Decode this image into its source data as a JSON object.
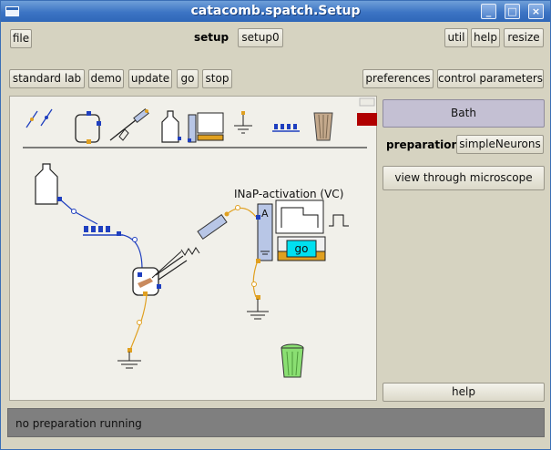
{
  "window": {
    "title": "catacomb.spatch.Setup"
  },
  "toolbar_row1": {
    "file": "file",
    "setup_label": "setup",
    "setup_select": "setup0",
    "util": "util",
    "help": "help",
    "resize": "resize"
  },
  "toolbar_row2": {
    "standard_lab": "standard lab",
    "demo": "demo",
    "update": "update",
    "go": "go",
    "stop": "stop",
    "preferences": "preferences",
    "control_parameters": "control parameters"
  },
  "canvas": {
    "experiment_label": "INaP-activation (VC)",
    "go_label": "go"
  },
  "right_panel": {
    "bath": "Bath",
    "preparation_label": "preparation",
    "preparation_value": "simpleNeurons",
    "view_microscope": "view through microscope",
    "help": "help"
  },
  "status": {
    "text": "no preparation running"
  },
  "colors": {
    "titlebar": "#3c74c4",
    "window_bg": "#d6d3c1",
    "bath_button": "#c4c0d3",
    "wire_blue": "#1f3fbf",
    "wire_orange": "#e0a020",
    "go_cyan": "#00e0f0",
    "indicator_red": "#b00000",
    "status_bg": "#7f7f7f"
  }
}
